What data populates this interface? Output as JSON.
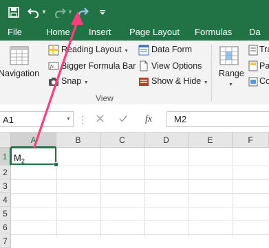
{
  "colors": {
    "accent": "#217346",
    "arrow": "#ff3d7f"
  },
  "qat": {
    "save_icon": "save-icon",
    "undo_icon": "undo-icon",
    "redo_icon": "redo-icon",
    "customize_icon": "customize-toolbar-icon"
  },
  "tabs": [
    "File",
    "Home",
    "Insert",
    "Page Layout",
    "Formulas",
    "Da"
  ],
  "ribbon": {
    "navigation_label": "Navigation",
    "items": {
      "reading_layout": "Reading Layout",
      "bigger_formula_bar": "Bigger Formula Bar",
      "snap": "Snap",
      "data_form": "Data Form",
      "view_options": "View Options",
      "show_hide": "Show & Hide"
    },
    "group_label": "View",
    "range_label": "Range",
    "right_items": [
      "Tra",
      "Pa",
      "Co"
    ]
  },
  "formula_bar": {
    "name_box": "A1",
    "fx_label": "fx",
    "content": "M2"
  },
  "grid": {
    "columns": [
      "A",
      "B",
      "C",
      "D",
      "E",
      "F"
    ],
    "rows": [
      "1",
      "2",
      "3",
      "4",
      "5",
      "6",
      "7"
    ],
    "cell_a1_main": "M",
    "cell_a1_sub": "2"
  }
}
